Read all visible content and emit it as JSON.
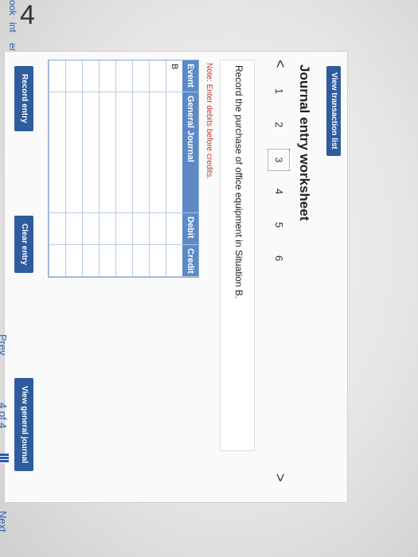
{
  "left_sidebar": {
    "items": [
      "ook",
      "int",
      "ences"
    ]
  },
  "header": {
    "number": "4"
  },
  "toolbar": {
    "view_transaction_list": "View transaction list"
  },
  "worksheet": {
    "title": "Journal entry worksheet",
    "steps": [
      "1",
      "2",
      "3",
      "4",
      "5",
      "6"
    ],
    "active_step": "3",
    "prev_arrow": "<",
    "next_arrow": ">",
    "prompt": "Record the purchase of office equipment in Situation B.",
    "note": "Note: Enter debits before credits."
  },
  "journal": {
    "headers": {
      "event": "Event",
      "general_journal": "General Journal",
      "debit": "Debit",
      "credit": "Credit"
    },
    "rows": [
      {
        "event": "B"
      },
      {
        "event": ""
      },
      {
        "event": ""
      },
      {
        "event": ""
      },
      {
        "event": ""
      },
      {
        "event": ""
      },
      {
        "event": ""
      },
      {
        "event": ""
      }
    ]
  },
  "buttons": {
    "record_entry": "Record entry",
    "clear_entry": "Clear entry",
    "view_general_journal": "View general journal"
  },
  "footer": {
    "prev": "Prev",
    "page": "4 of 4",
    "next": "Next"
  }
}
